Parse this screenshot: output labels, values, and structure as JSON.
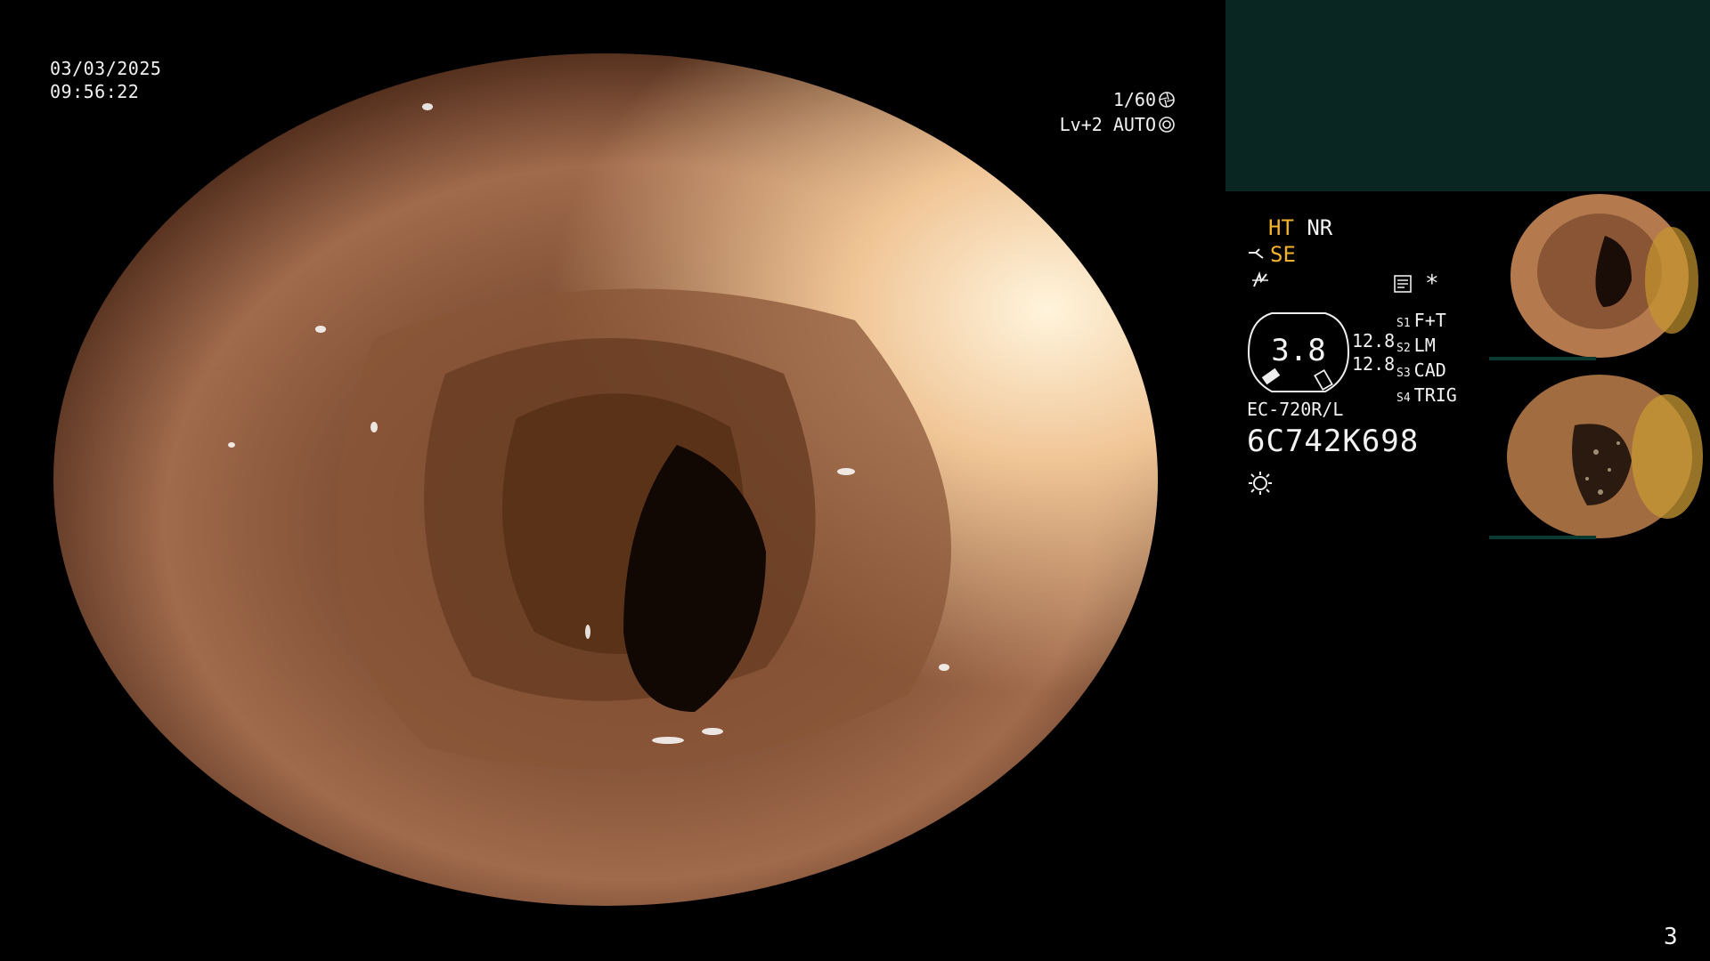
{
  "overlay": {
    "date": "03/03/2025",
    "time": "09:56:22",
    "shutter_speed": "1/60",
    "exposure": "Lv+2 AUTO",
    "page_number": "3"
  },
  "side_panel": {
    "mode_ht": "HT",
    "mode_nr": "NR",
    "mode_se": "SE",
    "gauge_value": "3.8",
    "gauge_right_top": "12.8",
    "gauge_right_bottom": "12.8",
    "switches": [
      {
        "key": "S1",
        "value": "F+T"
      },
      {
        "key": "S2",
        "value": "LM"
      },
      {
        "key": "S3",
        "value": "CAD"
      },
      {
        "key": "S4",
        "value": "TRIG"
      }
    ],
    "asterisk": "*",
    "scope_model": "EC-720R/L",
    "scope_serial": "6C742K698"
  },
  "colors": {
    "accent_yellow": "#f2b22c",
    "top_box": "#0a2622"
  },
  "icons": [
    "aperture-icon",
    "iris-icon",
    "scope-tip-icon",
    "waveform-icon",
    "memo-icon",
    "sun-icon"
  ]
}
